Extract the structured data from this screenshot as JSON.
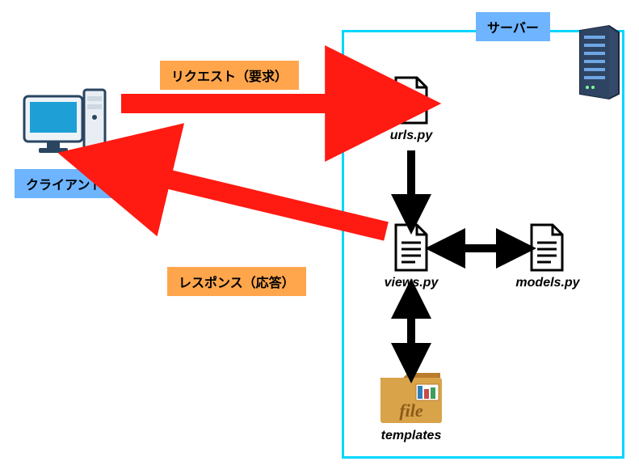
{
  "labels": {
    "server": "サーバー",
    "client": "クライアント",
    "request": "リクエスト（要求）",
    "response": "レスポンス（応答）"
  },
  "nodes": {
    "urls": "urls.py",
    "views": "views.py",
    "models": "models.py",
    "templates": "templates",
    "folder_caption": "file"
  },
  "colors": {
    "arrow_red": "#ff1a12",
    "arrow_black": "#000000",
    "box_cyan": "#00d6ff",
    "label_blue": "#6eb4ff",
    "label_orange": "#ffa64d",
    "client_screen": "#1e9fd6",
    "server_body": "#354a6b"
  }
}
